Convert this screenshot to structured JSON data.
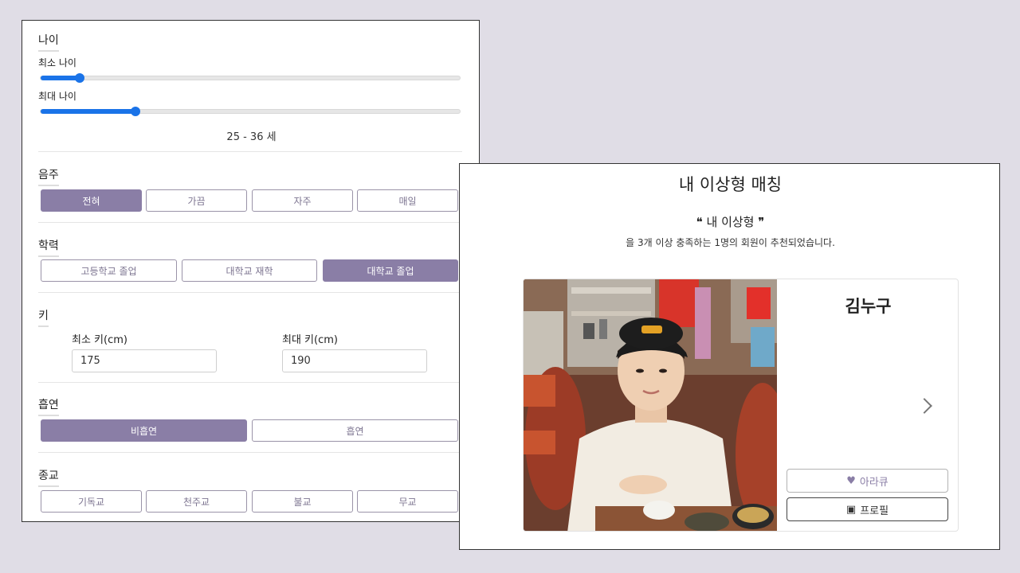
{
  "filters": {
    "age": {
      "title": "나이",
      "min_label": "최소 나이",
      "max_label": "최대 나이",
      "min_value": 25,
      "max_value": 36,
      "range_text": "25 - 36 세"
    },
    "drinking": {
      "title": "음주",
      "options": [
        "전혀",
        "가끔",
        "자주",
        "매일"
      ],
      "selected": "전혀"
    },
    "education": {
      "title": "학력",
      "options": [
        "고등학교 졸업",
        "대학교 재학",
        "대학교 졸업"
      ],
      "selected": "대학교 졸업"
    },
    "height": {
      "title": "키",
      "min_label": "최소 키(cm)",
      "max_label": "최대 키(cm)",
      "min_value": "175",
      "max_value": "190"
    },
    "smoking": {
      "title": "흡연",
      "options": [
        "비흡연",
        "흡연"
      ],
      "selected": "비흡연"
    },
    "religion": {
      "title": "종교",
      "options": [
        "기독교",
        "천주교",
        "불교",
        "무교"
      ]
    }
  },
  "match": {
    "title": "내 이상형 매칭",
    "quote_title": "❝ 내 이상형 ❞",
    "description": "을 3개 이상 충족하는 1명의 회원이 추천되었습니다.",
    "card": {
      "name": "김누구",
      "like_icon": "♥",
      "like_label": "아라큐",
      "profile_icon": "▣",
      "profile_label": "프로필",
      "next_icon": "chevron-right-icon"
    }
  },
  "colors": {
    "accent": "#8a7ea6",
    "slider": "#1a73e8",
    "background": "#e0dde6"
  }
}
